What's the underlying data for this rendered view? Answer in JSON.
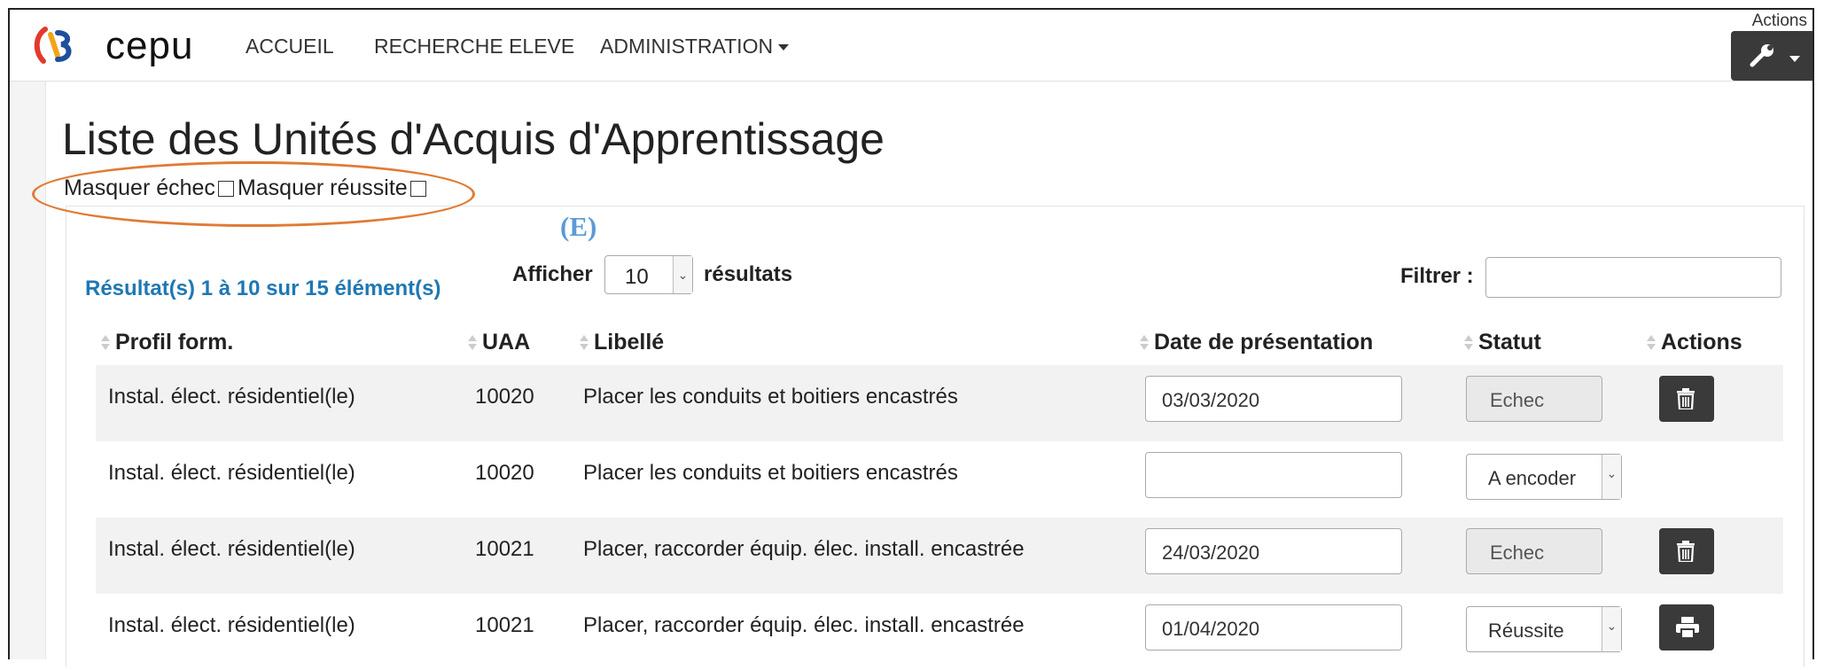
{
  "brand": {
    "name": "cepu",
    "logo": "cepu-logo"
  },
  "nav": {
    "home": "ACCUEIL",
    "student_search": "RECHERCHE ELEVE",
    "admin": "ADMINISTRATION"
  },
  "actions_menu": {
    "label": "Actions",
    "icon": "wrench-icon"
  },
  "page": {
    "title": "Liste des Unités d'Acquis d'Apprentissage",
    "hide_fail_label": "Masquer échec",
    "hide_success_label": "Masquer réussite",
    "hide_fail_checked": false,
    "hide_success_checked": false,
    "annotation_marker": "(E)",
    "annotation_color": "#e07b34"
  },
  "table_controls": {
    "results_info": "Résultat(s) 1 à 10 sur 15 élément(s)",
    "show_label": "Afficher",
    "page_size": "10",
    "results_label": "résultats",
    "filter_label": "Filtrer :",
    "filter_value": ""
  },
  "table": {
    "headers": {
      "profile": "Profil form.",
      "uaa": "UAA",
      "label": "Libellé",
      "date": "Date de présentation",
      "status": "Statut",
      "actions": "Actions"
    },
    "rows": [
      {
        "profile": "Instal. élect. résidentiel(le)",
        "uaa": "10020",
        "label": "Placer les conduits et boitiers encastrés",
        "date": "03/03/2020",
        "status": "Echec",
        "status_kind": "readonly",
        "action": "trash-icon"
      },
      {
        "profile": "Instal. élect. résidentiel(le)",
        "uaa": "10020",
        "label": "Placer les conduits et boitiers encastrés",
        "date": "",
        "status": "A encoder",
        "status_kind": "select",
        "action": ""
      },
      {
        "profile": "Instal. élect. résidentiel(le)",
        "uaa": "10021",
        "label": "Placer, raccorder équip. élec. install. encastrée",
        "date": "24/03/2020",
        "status": "Echec",
        "status_kind": "readonly",
        "action": "trash-icon"
      },
      {
        "profile": "Instal. élect. résidentiel(le)",
        "uaa": "10021",
        "label": "Placer, raccorder équip. élec. install. encastrée",
        "date": "01/04/2020",
        "status": "Réussite",
        "status_kind": "select",
        "action": "print-icon"
      }
    ]
  }
}
